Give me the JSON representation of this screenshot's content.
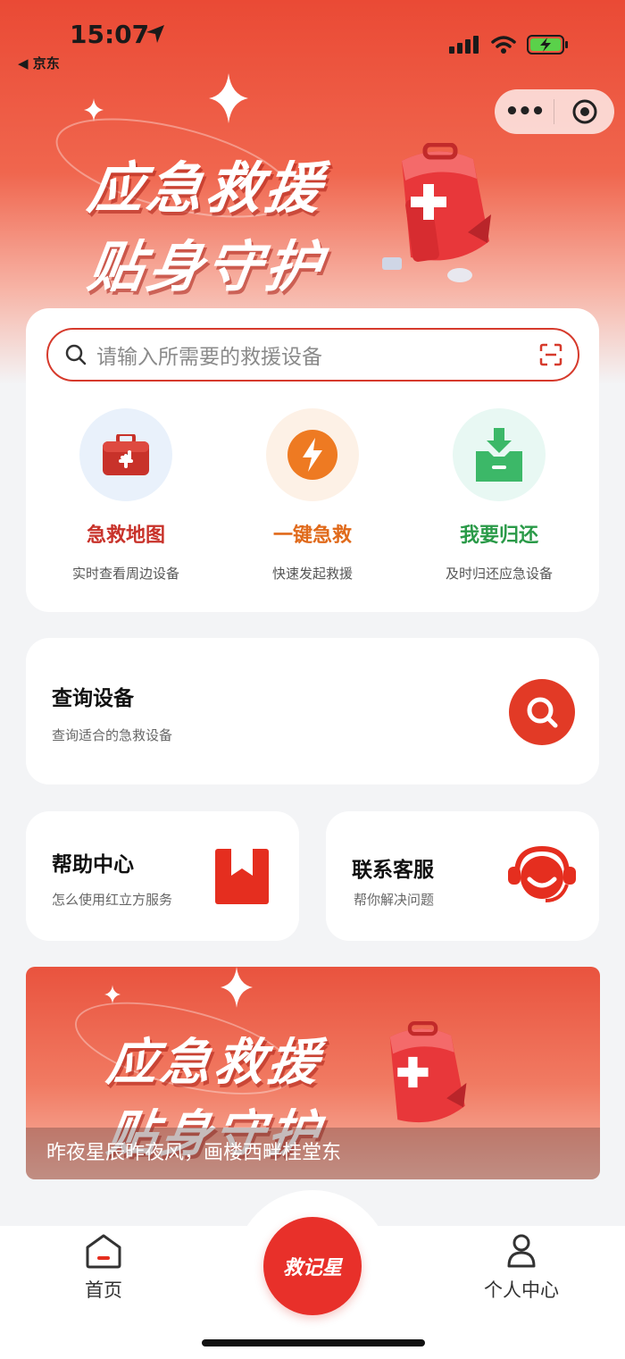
{
  "status": {
    "time": "15:07",
    "back_app": "◀ 京东"
  },
  "hero": {
    "line1": "应急救援",
    "line2": "贴身守护"
  },
  "search": {
    "placeholder": "请输入所需要的救援设备"
  },
  "features": [
    {
      "title": "急救地图",
      "subtitle": "实时查看周边设备",
      "color": "#c8322a",
      "icon": "first-aid-kit-icon",
      "bg": "#e9f1fb"
    },
    {
      "title": "一键急救",
      "subtitle": "快速发起救援",
      "color": "#e06a1b",
      "icon": "lightning-icon",
      "bg": "#fdf1e6"
    },
    {
      "title": "我要归还",
      "subtitle": "及时归还应急设备",
      "color": "#2a9a48",
      "icon": "return-box-icon",
      "bg": "#e8f8f3"
    }
  ],
  "query": {
    "title": "查询设备",
    "subtitle": "查询适合的急救设备"
  },
  "help": {
    "title": "帮助中心",
    "subtitle": "怎么使用红立方服务"
  },
  "service": {
    "title": "联系客服",
    "subtitle": "帮你解决问题"
  },
  "promo": {
    "line1": "应急救援",
    "line2": "贴身守护",
    "caption": "昨夜星辰昨夜风，画楼西畔桂堂东"
  },
  "tabbar": {
    "home": "首页",
    "center": "救记星",
    "profile": "个人中心"
  },
  "colors": {
    "primary": "#e23a26"
  }
}
